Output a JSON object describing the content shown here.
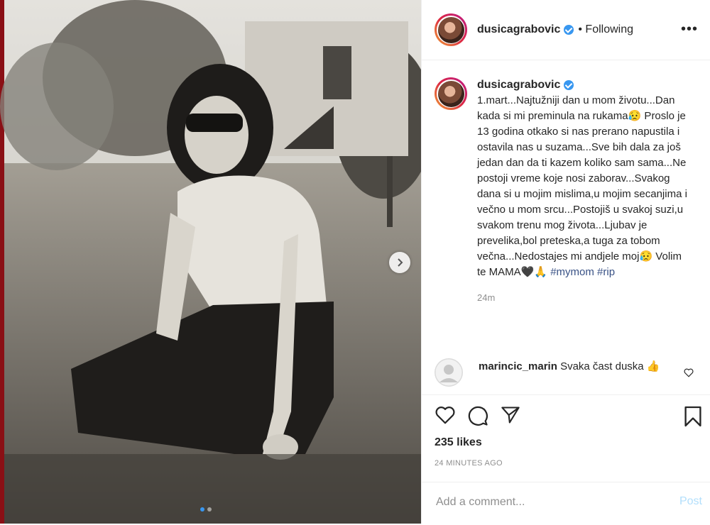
{
  "post": {
    "username": "dusicagrabovic",
    "follow_status": "• Following",
    "more_label": "•••",
    "caption": "1.mart...Najtužniji dan u mom životu...Dan kada si mi preminula na rukama😥 Proslo je 13 godina otkako si nas prerano napustila i ostavila nas u suzama...Sve bih dala za još jedan dan da ti kazem koliko sam sama...Ne postoji vreme koje nosi zaborav...Svakog dana si u mojim mislima,u mojim secanjima i večno u mom srcu...Postojiš u svakoj suzi,u svakom trenu mog života...Ljubav je prevelika,bol preteska,a tuga za tobom večna...Nedostajes mi andjele moj😥 Volim te MAMA🖤🙏 ",
    "hashtags": [
      "#mymom",
      "#rip"
    ],
    "caption_time": "24m",
    "likes": "235 likes",
    "posted_ago": "24 MINUTES AGO"
  },
  "comments": [
    {
      "username": "marincic_marin",
      "text": "Svaka čast duska 👍"
    }
  ],
  "composer": {
    "placeholder": "Add a comment...",
    "post_label": "Post"
  },
  "carousel": {
    "total_slides": 2,
    "current_slide": 1
  },
  "icons": [
    "heart-icon",
    "comment-icon",
    "share-icon",
    "bookmark-icon",
    "chevron-right-icon",
    "verified-icon",
    "like-comment-heart-icon"
  ],
  "colors": {
    "link": "#385185",
    "verified": "#3897f0",
    "post_disabled": "#b2dffc",
    "muted": "#8e8e8e"
  }
}
